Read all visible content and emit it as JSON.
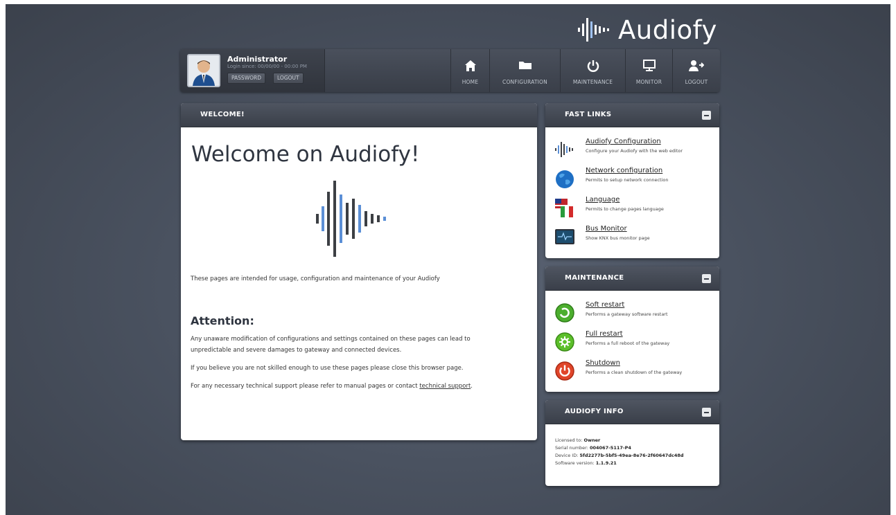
{
  "logo": {
    "text": "Audiofy"
  },
  "user": {
    "name": "Administrator",
    "last_login": "Login since: 00/00/00 - 00:00 PM",
    "password_label": "PASSWORD",
    "logout_label": "LOGOUT"
  },
  "nav": {
    "home": "HOME",
    "configuration": "CONFIGURATION",
    "maintenance": "MAINTENANCE",
    "monitor": "MONITOR",
    "logout": "LOGOUT"
  },
  "welcome": {
    "panel_title": "WELCOME!",
    "heading": "Welcome on Audiofy!",
    "intro": "These pages are intended for usage, configuration and maintenance of your Audiofy",
    "attention_heading": "Attention:",
    "attention_line1": "Any unaware modification of configurations and settings contained on these pages can lead to",
    "attention_line2": "unpredictable and severe damages to gateway and connected devices.",
    "skill_note": "If you believe you are not skilled enough to use these pages please close this browser page.",
    "support_prefix": "For any necessary technical support please refer to manual pages or contact ",
    "support_link": "technical support",
    "support_suffix": "."
  },
  "fast_links": {
    "panel_title": "FAST LINKS",
    "items": [
      {
        "title": "Audiofy Configuration",
        "desc": "Configure your Audiofy with the web editor",
        "icon": "waveform-icon"
      },
      {
        "title": "Network configuration",
        "desc": "Permits to setup network connection",
        "icon": "globe-icon"
      },
      {
        "title": "Language",
        "desc": "Permits to change pages language",
        "icon": "flags-icon"
      },
      {
        "title": "Bus Monitor",
        "desc": "Show KNX bus monitor page",
        "icon": "monitor-screen-icon"
      }
    ]
  },
  "maintenance": {
    "panel_title": "MAINTENANCE",
    "items": [
      {
        "title": "Soft restart",
        "desc": "Performs a gateway software restart",
        "icon": "soft-restart-icon",
        "color": "#4cae2e"
      },
      {
        "title": "Full restart",
        "desc": "Performs a full reboot of the gateway",
        "icon": "full-restart-icon",
        "color": "#5cbf2a"
      },
      {
        "title": "Shutdown",
        "desc": "Performs a clean shutdown of the gateway",
        "icon": "shutdown-icon",
        "color": "#e0452a"
      }
    ]
  },
  "info": {
    "panel_title": "AUDIOFY INFO",
    "licensed_label": "Licensed to: ",
    "licensed_value": "Owner",
    "serial_label": "Serial number: ",
    "serial_value": "004067-5117-P4",
    "device_label": "Device ID: ",
    "device_value": "5fd2277b-5bf5-49ea-8e76-2f60647dc48d",
    "software_label": "Software version: ",
    "software_value": "1.1.9.21"
  },
  "colors": {
    "accent_blue": "#5b8fd6",
    "wave_dark": "#3c3f44",
    "panel_header": "#3a3f49"
  }
}
